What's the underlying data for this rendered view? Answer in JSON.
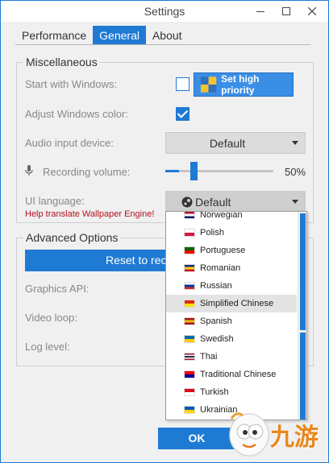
{
  "window": {
    "title": "Settings"
  },
  "titlebar": {
    "minimize_icon": "minimize-icon",
    "restore_icon": "restore-icon",
    "close_icon": "close-icon"
  },
  "tabs": [
    {
      "label": "Performance",
      "active": false
    },
    {
      "label": "General",
      "active": true
    },
    {
      "label": "About",
      "active": false
    }
  ],
  "misc": {
    "title": "Miscellaneous",
    "start_with_windows": {
      "label": "Start with Windows:",
      "checked": false
    },
    "set_priority_label": "Set high priority",
    "adjust_color": {
      "label": "Adjust Windows color:",
      "checked": true
    },
    "audio_input": {
      "label": "Audio input device:",
      "value": "Default"
    },
    "recording_volume": {
      "label": "Recording volume:",
      "value_text": "50%",
      "level": 0.5
    },
    "ui_language": {
      "label": "UI language:",
      "value": "Default"
    },
    "help_link": "Help translate Wallpaper Engine!"
  },
  "advanced": {
    "title": "Advanced Options",
    "reset_label": "Reset to rec",
    "graphics_api": "Graphics API:",
    "video_loop": "Video loop:",
    "log_level": "Log level:"
  },
  "language_options": [
    {
      "label": "Norwegian",
      "flag": [
        "#ba0c2f",
        "#ffffff",
        "#00205b"
      ]
    },
    {
      "label": "Polish",
      "flag": [
        "#ffffff",
        "#dc143c"
      ]
    },
    {
      "label": "Portuguese",
      "flag": [
        "#006600",
        "#ff0000"
      ]
    },
    {
      "label": "Romanian",
      "flag": [
        "#002b7f",
        "#fcd116",
        "#ce1126"
      ]
    },
    {
      "label": "Russian",
      "flag": [
        "#ffffff",
        "#0039a6",
        "#d52b1e"
      ]
    },
    {
      "label": "Simplified Chinese",
      "flag": [
        "#de2910",
        "#ffde00"
      ],
      "highlighted": true
    },
    {
      "label": "Spanish",
      "flag": [
        "#aa151b",
        "#f1bf00",
        "#aa151b"
      ]
    },
    {
      "label": "Swedish",
      "flag": [
        "#006aa7",
        "#fecc00"
      ]
    },
    {
      "label": "Thai",
      "flag": [
        "#a51931",
        "#f4f5f8",
        "#2d2a4a",
        "#f4f5f8",
        "#a51931"
      ]
    },
    {
      "label": "Traditional Chinese",
      "flag": [
        "#fe0000",
        "#000095"
      ]
    },
    {
      "label": "Turkish",
      "flag": [
        "#e30a17",
        "#ffffff"
      ]
    },
    {
      "label": "Ukrainian",
      "flag": [
        "#0057b7",
        "#ffd700"
      ]
    }
  ],
  "footer": {
    "ok_label": "OK"
  },
  "watermark": {
    "text": "九游"
  },
  "colors": {
    "accent": "#1f7ad3",
    "help_link": "#b0111e"
  }
}
